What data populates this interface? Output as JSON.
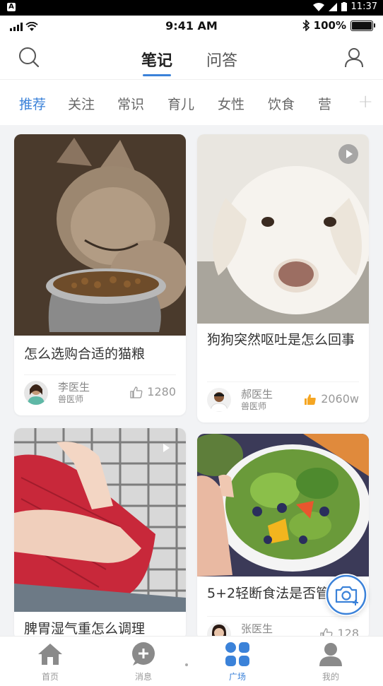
{
  "android_status": {
    "icon_letter": "A",
    "time": "11:37"
  },
  "ios_status": {
    "time": "9:41 AM",
    "battery": "100%"
  },
  "header": {
    "tabs": [
      {
        "label": "笔记"
      },
      {
        "label": "问答"
      }
    ]
  },
  "categories": [
    "推荐",
    "关注",
    "常识",
    "育儿",
    "女性",
    "饮食",
    "营"
  ],
  "categories_add": "+",
  "cards": [
    {
      "title": "怎么选购合适的猫粮",
      "author": "李医生",
      "role": "兽医师",
      "likes": "1280"
    },
    {
      "title": "狗狗突然呕吐是怎么回事",
      "author": "郝医生",
      "role": "兽医师",
      "likes": "2060w"
    },
    {
      "title": "脾胃湿气重怎么调理",
      "author": "",
      "role": "",
      "likes": ""
    },
    {
      "title": "5+2轻断食法是否管",
      "author": "张医生",
      "role": "",
      "likes": "128"
    }
  ],
  "bottom_nav": [
    {
      "label": "首页"
    },
    {
      "label": "消息"
    },
    {
      "label": "广场"
    },
    {
      "label": "我的"
    }
  ],
  "colors": {
    "accent": "#3b82d9",
    "like_active": "#f5a623"
  }
}
